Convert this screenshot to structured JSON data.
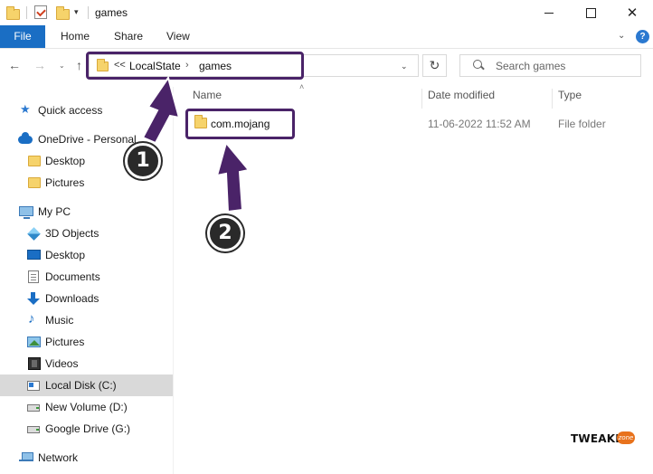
{
  "window": {
    "title": "games",
    "qa_caret": "▾",
    "minimize": "",
    "maximize": "",
    "close": "✕"
  },
  "ribbon": {
    "tabs": [
      "File",
      "Home",
      "Share",
      "View"
    ],
    "expand": "⌄",
    "help": "?"
  },
  "nav": {
    "back": "←",
    "forward": "→",
    "recent": "⌄",
    "up": "↑",
    "address_overflow": "<<",
    "path": [
      "LocalState",
      "games"
    ],
    "path_sep": "›",
    "address_dropdown": "⌄",
    "refresh": "↻",
    "search_placeholder": "Search games"
  },
  "sidebar": {
    "items": [
      {
        "label": "Quick access",
        "icon": "star-icon"
      },
      {
        "label": "OneDrive - Personal",
        "icon": "cloud-icon"
      },
      {
        "label": "Desktop",
        "icon": "folder-icon"
      },
      {
        "label": "Pictures",
        "icon": "folder-icon"
      },
      {
        "label": "My PC",
        "icon": "computer-icon"
      },
      {
        "label": "3D Objects",
        "icon": "3d-objects-icon"
      },
      {
        "label": "Desktop",
        "icon": "desktop-icon"
      },
      {
        "label": "Documents",
        "icon": "documents-icon"
      },
      {
        "label": "Downloads",
        "icon": "download-icon"
      },
      {
        "label": "Music",
        "icon": "music-icon"
      },
      {
        "label": "Pictures",
        "icon": "pictures-icon"
      },
      {
        "label": "Videos",
        "icon": "videos-icon"
      },
      {
        "label": "Local Disk (C:)",
        "icon": "local-disk-icon",
        "selected": true
      },
      {
        "label": "New Volume (D:)",
        "icon": "drive-icon"
      },
      {
        "label": "Google Drive (G:)",
        "icon": "drive-icon"
      },
      {
        "label": "Network",
        "icon": "network-icon"
      }
    ]
  },
  "list": {
    "columns": [
      "Name",
      "Date modified",
      "Type"
    ],
    "sort_caret": "˄",
    "rows": [
      {
        "name": "com.mojang",
        "date": "11-06-2022 11:52 AM",
        "type": "File folder"
      }
    ]
  },
  "annotations": {
    "badge1": "1",
    "badge2": "2",
    "color": "#4a2368"
  },
  "watermark": {
    "brand": "TWEAKER",
    "zone": "zone"
  },
  "colors": {
    "file_tab": "#1a6ec4",
    "selected_item": "#d9d9d9",
    "folder": "#f6d36b"
  }
}
